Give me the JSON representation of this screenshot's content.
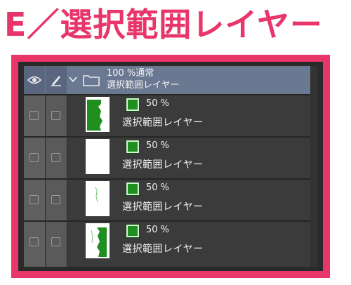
{
  "heading": {
    "text": "E／選択範囲レイヤー",
    "color": "#e8356a"
  },
  "folder": {
    "chevron": "chevron-down-icon",
    "line1": "100 %通常",
    "line2": "選択範囲レイヤー",
    "visibility_icon": "eye-icon",
    "edit_icon": "pen-icon"
  },
  "layers": [
    {
      "opacity": "50 %",
      "name": "選択範囲レイヤー",
      "thumb": "green-shape-left",
      "color": "#1f8f1f"
    },
    {
      "opacity": "50 %",
      "name": "選択範囲レイヤー",
      "thumb": "blank",
      "color": "#1f8f1f"
    },
    {
      "opacity": "50 %",
      "name": "選択範囲レイヤー",
      "thumb": "faint-marks",
      "color": "#1f8f1f"
    },
    {
      "opacity": "50 %",
      "name": "選択範囲レイヤー",
      "thumb": "green-shape-right",
      "color": "#1f8f1f"
    }
  ],
  "accent_frame_color": "#e8356a"
}
